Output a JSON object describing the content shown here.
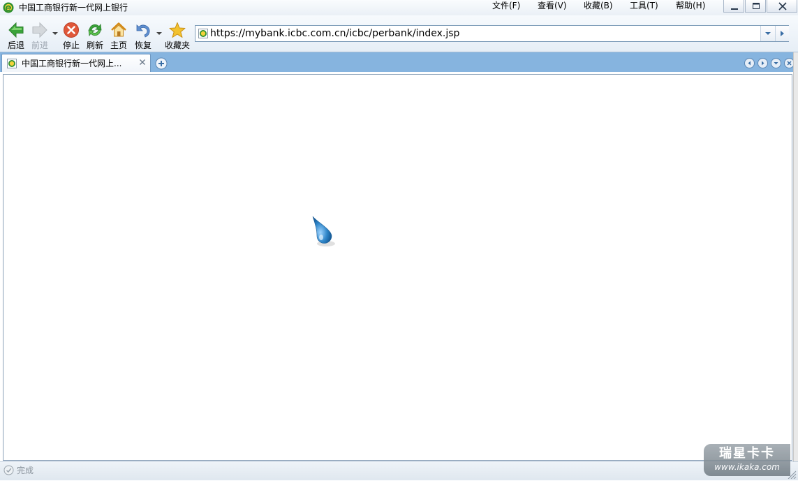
{
  "window": {
    "title": "中国工商银行新一代网上银行",
    "icon": "browser-logo-icon"
  },
  "menu": {
    "items": [
      {
        "label": "文件(F)"
      },
      {
        "label": "查看(V)"
      },
      {
        "label": "收藏(B)"
      },
      {
        "label": "工具(T)"
      },
      {
        "label": "帮助(H)"
      }
    ]
  },
  "window_controls": {
    "minimize": "minimize-icon",
    "maximize": "maximize-icon",
    "close": "close-icon"
  },
  "toolbar": {
    "back_label": "后退",
    "forward_label": "前进",
    "stop_label": "停止",
    "refresh_label": "刷新",
    "home_label": "主页",
    "restore_label": "恢复",
    "favorites_label": "收藏夹"
  },
  "address": {
    "url": "https://mybank.icbc.com.cn/icbc/perbank/index.jsp"
  },
  "tabs": [
    {
      "title": "中国工商银行新一代网上...",
      "active": true
    }
  ],
  "status": {
    "text": "完成"
  },
  "watermark": {
    "line1": "瑞星卡卡",
    "line2": "www.ikaka.com"
  },
  "colors": {
    "tab_strip": "#86b4df",
    "accent_green": "#3aa33a",
    "stop_red": "#e0583a",
    "favorites_gold": "#f2c230",
    "loading_blue": "#2f86c9"
  }
}
